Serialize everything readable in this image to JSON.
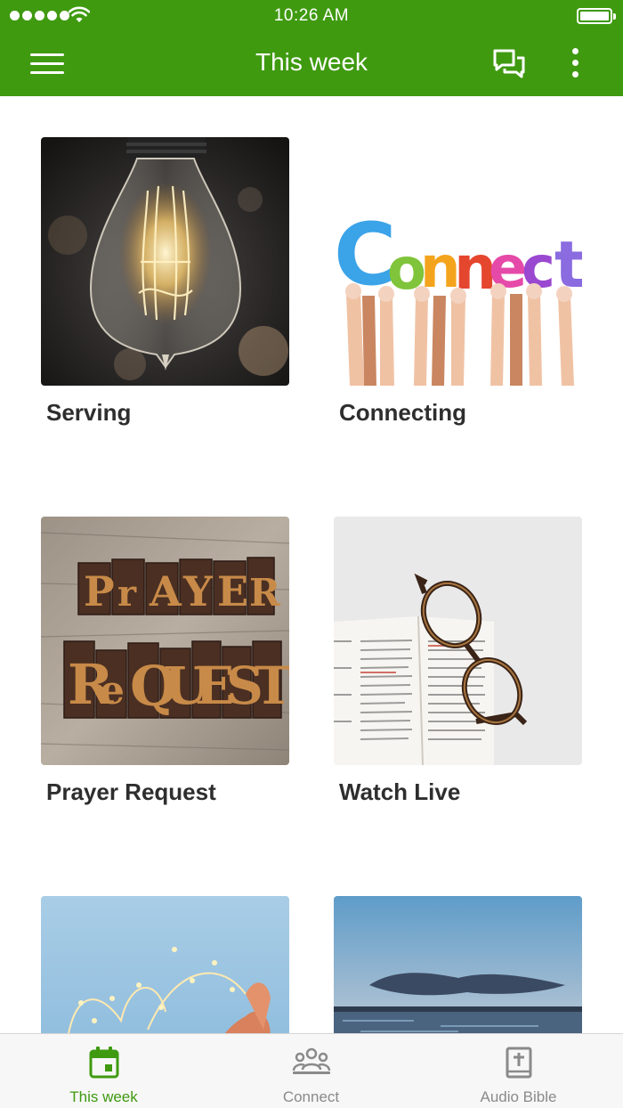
{
  "status_bar": {
    "time": "10:26 AM"
  },
  "nav": {
    "title": "This week"
  },
  "colors": {
    "brand": "#3f9a10",
    "tab_inactive": "#8a8a8a",
    "label": "#2e2e2e"
  },
  "icons": {
    "menu": "hamburger-menu-icon",
    "chat": "chat-bubbles-icon",
    "more": "more-vertical-icon"
  },
  "cards": [
    {
      "label": "Serving",
      "image": "light-bulb-photo"
    },
    {
      "label": "Connecting",
      "image": "connect-letters-hands-photo"
    },
    {
      "label": "Prayer Request",
      "image": "prayer-request-wood-type-photo"
    },
    {
      "label": "Watch Live",
      "image": "glasses-on-bible-photo"
    },
    {
      "label": "",
      "image": "hands-fairy-lights-photo"
    },
    {
      "label": "",
      "image": "sunset-sea-photo"
    }
  ],
  "tabs": [
    {
      "label": "This week",
      "icon": "calendar-icon",
      "active": true
    },
    {
      "label": "Connect",
      "icon": "group-icon",
      "active": false
    },
    {
      "label": "Audio Bible",
      "icon": "bible-icon",
      "active": false
    }
  ]
}
